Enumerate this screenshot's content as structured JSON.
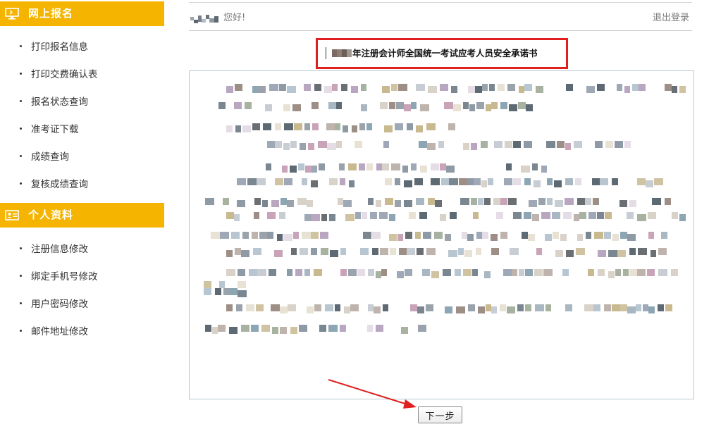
{
  "sidebar": {
    "section1": {
      "title": "网上报名",
      "icon": "monitor-icon",
      "color": "#f5b400",
      "items": [
        "打印报名信息",
        "打印交费确认表",
        "报名状态查询",
        "准考证下载",
        "成绩查询",
        "复核成绩查询"
      ]
    },
    "section2": {
      "title": "个人资料",
      "icon": "id-card-icon",
      "color": "#f5b400",
      "items": [
        "注册信息修改",
        "绑定手机号修改",
        "用户密码修改",
        "邮件地址修改"
      ]
    }
  },
  "header": {
    "greeting": "您好!",
    "logout_label": "退出登录"
  },
  "main": {
    "title": "年注册会计师全国统一考试应考人员安全承诺书",
    "next_button_label": "下一步"
  },
  "colors": {
    "accent": "#f5b400",
    "highlight": "#e02020",
    "content_border": "#b8c7cf"
  }
}
